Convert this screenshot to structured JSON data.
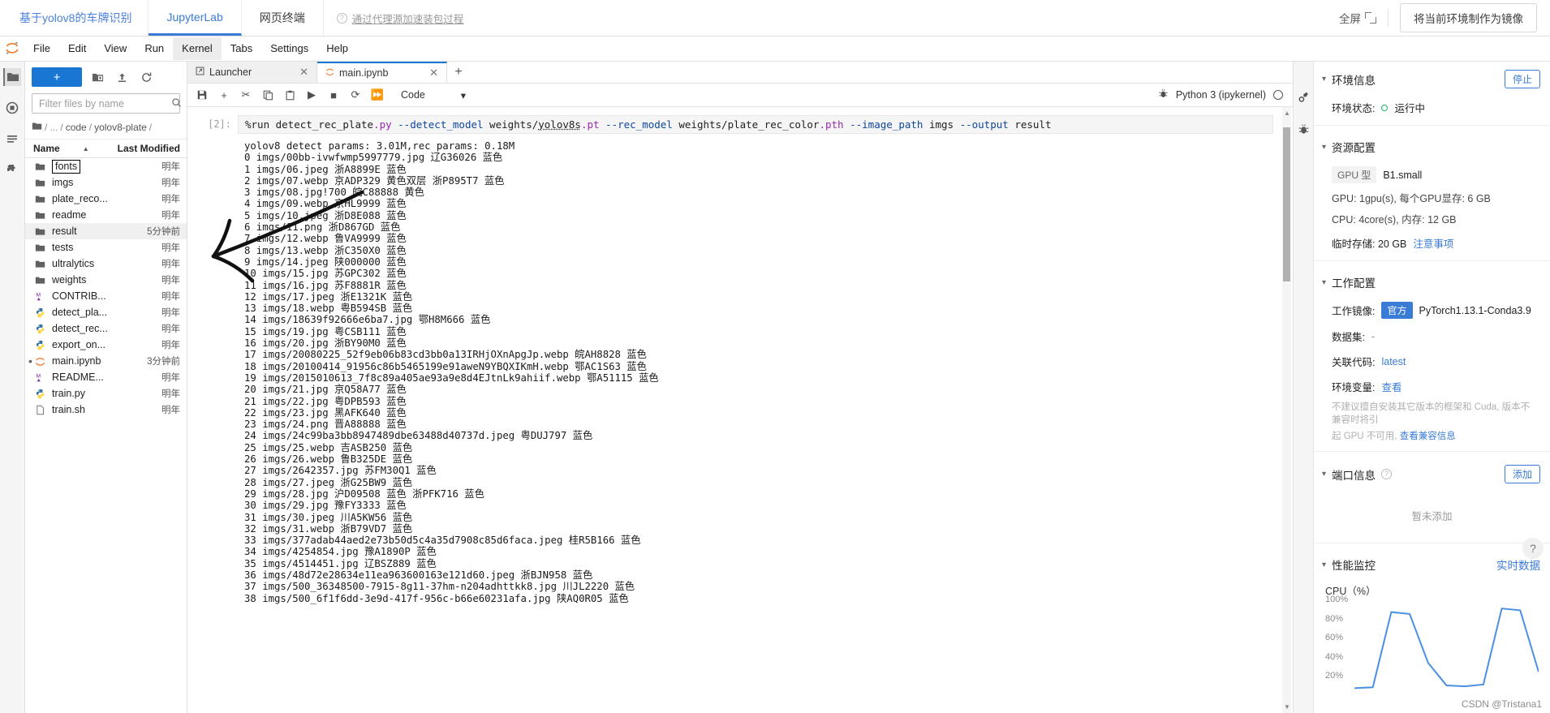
{
  "header": {
    "brand": "基于yolov8的车牌识别",
    "tabs": [
      {
        "label": "JupyterLab",
        "active": true
      },
      {
        "label": "网页终端",
        "active": false
      }
    ],
    "note": "通过代理源加速装包过程",
    "note_icon": "question-icon",
    "fullscreen_label": "全屏",
    "mirror_button": "将当前环境制作为镜像"
  },
  "menubar": {
    "items": [
      "File",
      "Edit",
      "View",
      "Run",
      "Kernel",
      "Tabs",
      "Settings",
      "Help"
    ],
    "hovered": "Kernel"
  },
  "left_rail": {
    "icons": [
      "folder-icon",
      "running-terminals-icon",
      "commands-icon",
      "table-of-contents-icon",
      "extensions-icon"
    ]
  },
  "filebrowser": {
    "new_button": "+",
    "toolbar_icons": [
      "new-folder-icon",
      "upload-icon",
      "refresh-icon"
    ],
    "filter_placeholder": "Filter files by name",
    "filter_value": "",
    "search_icon": "search-icon",
    "breadcrumb": [
      "/",
      "...",
      "code",
      "yolov8-plate",
      "/"
    ],
    "columns": {
      "name": "Name",
      "modified": "Last Modified"
    },
    "sort_caret": "▲",
    "rows": [
      {
        "name": "fonts",
        "icon": "folder-icon",
        "modified": "明年",
        "boxed": true,
        "selected": false
      },
      {
        "name": "imgs",
        "icon": "folder-icon",
        "modified": "明年",
        "boxed": false,
        "selected": false
      },
      {
        "name": "plate_reco...",
        "icon": "folder-icon",
        "modified": "明年",
        "boxed": false,
        "selected": false
      },
      {
        "name": "readme",
        "icon": "folder-icon",
        "modified": "明年",
        "boxed": false,
        "selected": false
      },
      {
        "name": "result",
        "icon": "folder-icon",
        "modified": "5分钟前",
        "boxed": false,
        "selected": true
      },
      {
        "name": "tests",
        "icon": "folder-icon",
        "modified": "明年",
        "boxed": false,
        "selected": false
      },
      {
        "name": "ultralytics",
        "icon": "folder-icon",
        "modified": "明年",
        "boxed": false,
        "selected": false
      },
      {
        "name": "weights",
        "icon": "folder-icon",
        "modified": "明年",
        "boxed": false,
        "selected": false
      },
      {
        "name": "CONTRIB...",
        "icon": "markdown-icon",
        "modified": "明年",
        "boxed": false,
        "selected": false
      },
      {
        "name": "detect_pla...",
        "icon": "python-icon",
        "modified": "明年",
        "boxed": false,
        "selected": false
      },
      {
        "name": "detect_rec...",
        "icon": "python-icon",
        "modified": "明年",
        "boxed": false,
        "selected": false
      },
      {
        "name": "export_on...",
        "icon": "python-icon",
        "modified": "明年",
        "boxed": false,
        "selected": false
      },
      {
        "name": "main.ipynb",
        "icon": "notebook-icon",
        "modified": "3分钟前",
        "boxed": false,
        "selected": false,
        "running": true
      },
      {
        "name": "README...",
        "icon": "markdown-icon",
        "modified": "明年",
        "boxed": false,
        "selected": false
      },
      {
        "name": "train.py",
        "icon": "python-icon",
        "modified": "明年",
        "boxed": false,
        "selected": false
      },
      {
        "name": "train.sh",
        "icon": "file-icon",
        "modified": "明年",
        "boxed": false,
        "selected": false
      }
    ]
  },
  "notebook": {
    "tabs": [
      {
        "label": "Launcher",
        "icon": "launcher-icon",
        "active": false
      },
      {
        "label": "main.ipynb",
        "icon": "notebook-icon",
        "active": true
      }
    ],
    "add_tab": "+",
    "toolbar_icons": [
      "save-icon",
      "insert-cell-icon",
      "cut-icon",
      "copy-icon",
      "paste-icon",
      "run-icon",
      "stop-icon",
      "restart-icon",
      "restart-run-all-icon"
    ],
    "cell_type": "Code",
    "cell_type_caret": "▾",
    "bug_icon": "debugger-icon",
    "kernel_name": "Python 3 (ipykernel)",
    "kernel_status": "idle-circle",
    "prompt": "[2]:",
    "input_code": "%run detect_rec_plate.py --detect_model weights/yolov8s.pt  --rec_model weights/plate_rec_color.pth --image_path imgs --output result",
    "output_lines": [
      "yolov8 detect params: 3.01M,rec params: 0.18M",
      "0 imgs/00bb-ivwfwmp5997779.jpg 辽G36026 蓝色",
      "1 imgs/06.jpeg 浙A8899E 蓝色",
      "2 imgs/07.webp 京ADP329 黄色双层 浙P895T7 蓝色",
      "3 imgs/08.jpg!700 皖C88888 黄色",
      "4 imgs/09.webp 京HL9999 蓝色",
      "5 imgs/10.jpeg 浙D8E088 蓝色",
      "6 imgs/11.png 浙D867GD 蓝色",
      "7 imgs/12.webp 鲁VA9999 蓝色",
      "8 imgs/13.webp 浙C350X0 蓝色",
      "9 imgs/14.jpeg 陕000000 蓝色",
      "10 imgs/15.jpg 苏GPC302 蓝色",
      "11 imgs/16.jpg 苏F8881R 蓝色",
      "12 imgs/17.jpeg 浙E1321K 蓝色",
      "13 imgs/18.webp 粤B594SB 蓝色",
      "14 imgs/18639f92666e6ba7.jpg 鄂H8M666 蓝色",
      "15 imgs/19.jpg 粤CSB111 蓝色",
      "16 imgs/20.jpg 浙BY90M0 蓝色",
      "17 imgs/20080225_52f9eb06b83cd3bb0a13IRHjOXnApgJp.webp 皖AH8828 蓝色",
      "18 imgs/20100414_91956c86b5465199e91aweN9YBQXIKmH.webp 鄂AC1S63 蓝色",
      "19 imgs/2015010613_7f8c89a405ae93a9e8d4EJtnLk9ahiif.webp 鄂A51115 蓝色",
      "20 imgs/21.jpg 京Q58A77 蓝色",
      "21 imgs/22.jpg 粤DPB593 蓝色",
      "22 imgs/23.jpg 黑AFK640 蓝色",
      "23 imgs/24.png 晋A88888 蓝色",
      "24 imgs/24c99ba3bb8947489dbe63488d40737d.jpeg 粤DUJ797 蓝色",
      "25 imgs/25.webp 吉ASB250 蓝色",
      "26 imgs/26.webp 鲁B325DE 蓝色",
      "27 imgs/2642357.jpg 苏FM30Q1 蓝色",
      "28 imgs/27.jpeg 浙G25BW9 蓝色",
      "29 imgs/28.jpg 沪D09508 蓝色 浙PFK716 蓝色",
      "30 imgs/29.jpg 豫FY3333 蓝色",
      "31 imgs/30.jpeg 川A5KW56 蓝色",
      "32 imgs/31.webp 浙B79VD7 蓝色",
      "33 imgs/377adab44aed2e73b50d5c4a35d7908c85d6faca.jpeg 桂R5B166 蓝色",
      "34 imgs/4254854.jpg 豫A1890P 蓝色",
      "35 imgs/4514451.jpg 辽BSZ889 蓝色",
      "36 imgs/48d72e28634e11ea963600163e121d60.jpeg 浙BJN958 蓝色",
      "37 imgs/500_36348500-7915-8g11-37hm-n204adhttkk8.jpg 川JL2220 蓝色",
      "38 imgs/500_6f1f6dd-3e9d-417f-956c-b66e60231afa.jpg 陕AQ0R05 蓝色"
    ]
  },
  "right_rail": {
    "icons": [
      "property-inspector-icon",
      "debugger-icon"
    ]
  },
  "env_panel": {
    "sections": {
      "env_info": {
        "title": "环境信息",
        "stop_button": "停止",
        "status_label": "环境状态:",
        "status_value": "运行中"
      },
      "resource": {
        "title": "资源配置",
        "gpu_type_label": "GPU 型",
        "gpu_type_value": "B1.small",
        "gpu_line": "GPU: 1gpu(s), 每个GPU显存: 6 GB",
        "cpu_line": "CPU: 4core(s), 内存: 12 GB",
        "storage_line": "临时存储: 20 GB",
        "storage_link": "注意事项"
      },
      "workspace": {
        "title": "工作配置",
        "image_label": "工作镜像:",
        "image_badge": "官方",
        "image_value": "PyTorch1.13.1-Conda3.9",
        "dataset_label": "数据集:",
        "dataset_value": "-",
        "code_label": "关联代码:",
        "code_value": "latest",
        "envvar_label": "环境变量:",
        "envvar_value": "查看",
        "warn_line1": "不建议擅自安装其它版本的框架和 Cuda, 版本不兼容时将引",
        "warn_line2": "起 GPU 不可用,",
        "warn_link": "查看兼容信息"
      },
      "ports": {
        "title": "端口信息",
        "help_icon": "question-icon",
        "add_button": "添加",
        "empty_text": "暂未添加"
      },
      "perf": {
        "title": "性能监控",
        "realtime_link": "实时数据"
      }
    }
  },
  "chart_data": {
    "type": "line",
    "title": "CPU（%）",
    "ylabel": "",
    "xlabel": "",
    "ylim": [
      0,
      100
    ],
    "ytick_labels": [
      "100%",
      "80%",
      "60%",
      "40%",
      "20%"
    ],
    "yticks": [
      100,
      80,
      60,
      40,
      20
    ],
    "series": [
      {
        "name": "CPU",
        "color": "#4a90e2",
        "x": [
          0,
          1,
          2,
          3,
          4,
          5,
          6,
          7,
          8,
          9,
          10
        ],
        "values": [
          2,
          3,
          86,
          84,
          30,
          5,
          4,
          6,
          90,
          88,
          20
        ]
      }
    ],
    "grid": false,
    "legend": "none"
  },
  "watermark": "CSDN @Tristana1",
  "help_fab": "?"
}
